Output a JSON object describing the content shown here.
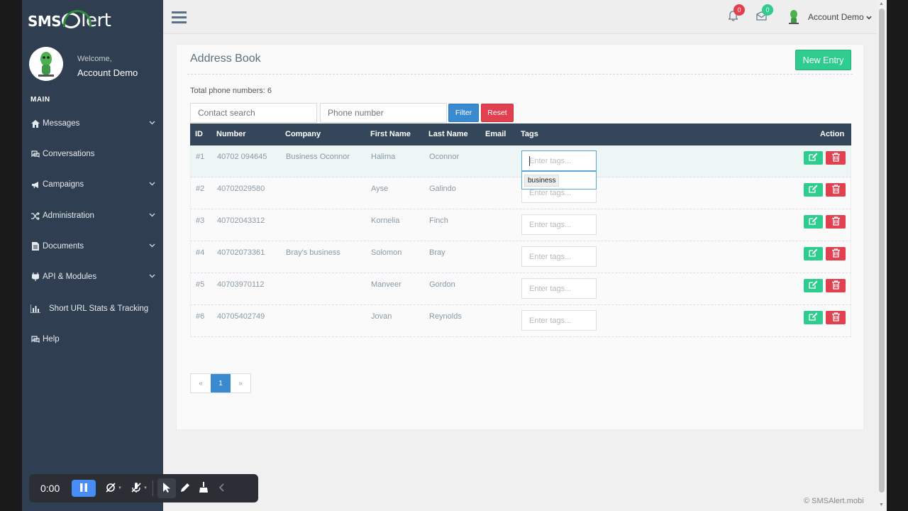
{
  "sidebar": {
    "logo_sms": "SMS",
    "logo_alert": "lert",
    "welcome": "Welcome,",
    "user_name": "Account Demo",
    "section_label": "MAIN",
    "items": [
      {
        "label": "Messages",
        "icon": "home-icon",
        "has_submenu": true
      },
      {
        "label": "Conversations",
        "icon": "chat-icon",
        "has_submenu": false
      },
      {
        "label": "Campaigns",
        "icon": "megaphone-icon",
        "has_submenu": true
      },
      {
        "label": "Administration",
        "icon": "shuffle-icon",
        "has_submenu": true
      },
      {
        "label": "Documents",
        "icon": "document-icon",
        "has_submenu": true
      },
      {
        "label": "API & Modules",
        "icon": "plug-icon",
        "has_submenu": true
      },
      {
        "label": "Short URL Stats & Tracking",
        "icon": "bar-chart-icon",
        "has_submenu": false
      },
      {
        "label": "Help",
        "icon": "chat-icon",
        "has_submenu": false
      }
    ]
  },
  "topbar": {
    "notifications_count": "0",
    "messages_count": "0",
    "account_label": "Account Demo"
  },
  "page": {
    "title": "Address Book",
    "new_entry_label": "New Entry",
    "total_text": "Total phone numbers: 6",
    "contact_search_placeholder": "Contact search",
    "phone_placeholder": "Phone number",
    "filter_label": "Filter",
    "reset_label": "Reset"
  },
  "table": {
    "headers": {
      "id": "ID",
      "number": "Number",
      "company": "Company",
      "first_name": "First Name",
      "last_name": "Last Name",
      "email": "Email",
      "tags": "Tags",
      "action": "Action"
    },
    "tags_placeholder": "Enter tags...",
    "tag_suggestion": "business",
    "rows": [
      {
        "id": "#1",
        "number": "40702 094645",
        "company": "Business Oconnor",
        "first_name": "Halima",
        "last_name": "Oconnor",
        "email": ""
      },
      {
        "id": "#2",
        "number": "40702029580",
        "company": "",
        "first_name": "Ayse",
        "last_name": "Galindo",
        "email": ""
      },
      {
        "id": "#3",
        "number": "40702043312",
        "company": "",
        "first_name": "Kornelia",
        "last_name": "Finch",
        "email": ""
      },
      {
        "id": "#4",
        "number": "40702073361",
        "company": "Bray's business",
        "first_name": "Solomon",
        "last_name": "Bray",
        "email": ""
      },
      {
        "id": "#5",
        "number": "40703970112",
        "company": "",
        "first_name": "Manveer",
        "last_name": "Gordon",
        "email": ""
      },
      {
        "id": "#6",
        "number": "40705402749",
        "company": "",
        "first_name": "Jovan",
        "last_name": "Reynolds",
        "email": ""
      }
    ]
  },
  "pagination": {
    "prev": "«",
    "current": "1",
    "next": "»"
  },
  "footer": {
    "copyright": "© SMSAlert.mobi"
  },
  "recorder": {
    "time": "0:00"
  },
  "colors": {
    "sidebar": "#2f3e50",
    "accent_green": "#2ecc8f",
    "danger": "#e0404f",
    "primary": "#3a8ad0",
    "table_header": "#34475a"
  }
}
